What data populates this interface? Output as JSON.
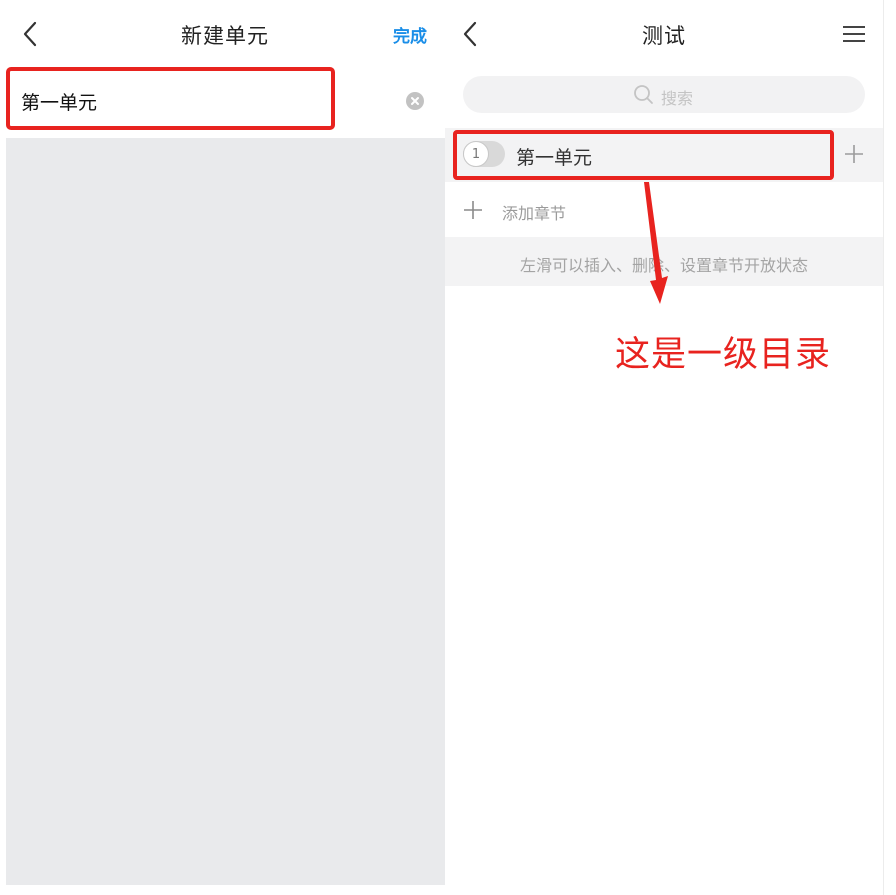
{
  "left": {
    "header": {
      "title": "新建单元",
      "done_label": "完成",
      "back_icon": "chevron-left-icon"
    },
    "input": {
      "value": "第一单元",
      "clear_icon": "clear-circle-icon"
    }
  },
  "right": {
    "header": {
      "title": "测试",
      "back_icon": "chevron-left-icon",
      "menu_icon": "hamburger-menu-icon"
    },
    "search": {
      "placeholder": "搜索",
      "icon": "search-icon"
    },
    "unit_item": {
      "index": "1",
      "label": "第一单元",
      "add_icon": "plus-icon"
    },
    "add_section": {
      "label": "添加章节",
      "icon": "plus-icon"
    },
    "hint": "左滑可以插入、删除、设置章节开放状态",
    "annotation": "这是一级目录"
  },
  "colors": {
    "accent": "#1a8ee8",
    "annotation_red": "#e8231f",
    "panel_gray": "#e9eaec",
    "row_gray": "#f3f3f4"
  }
}
